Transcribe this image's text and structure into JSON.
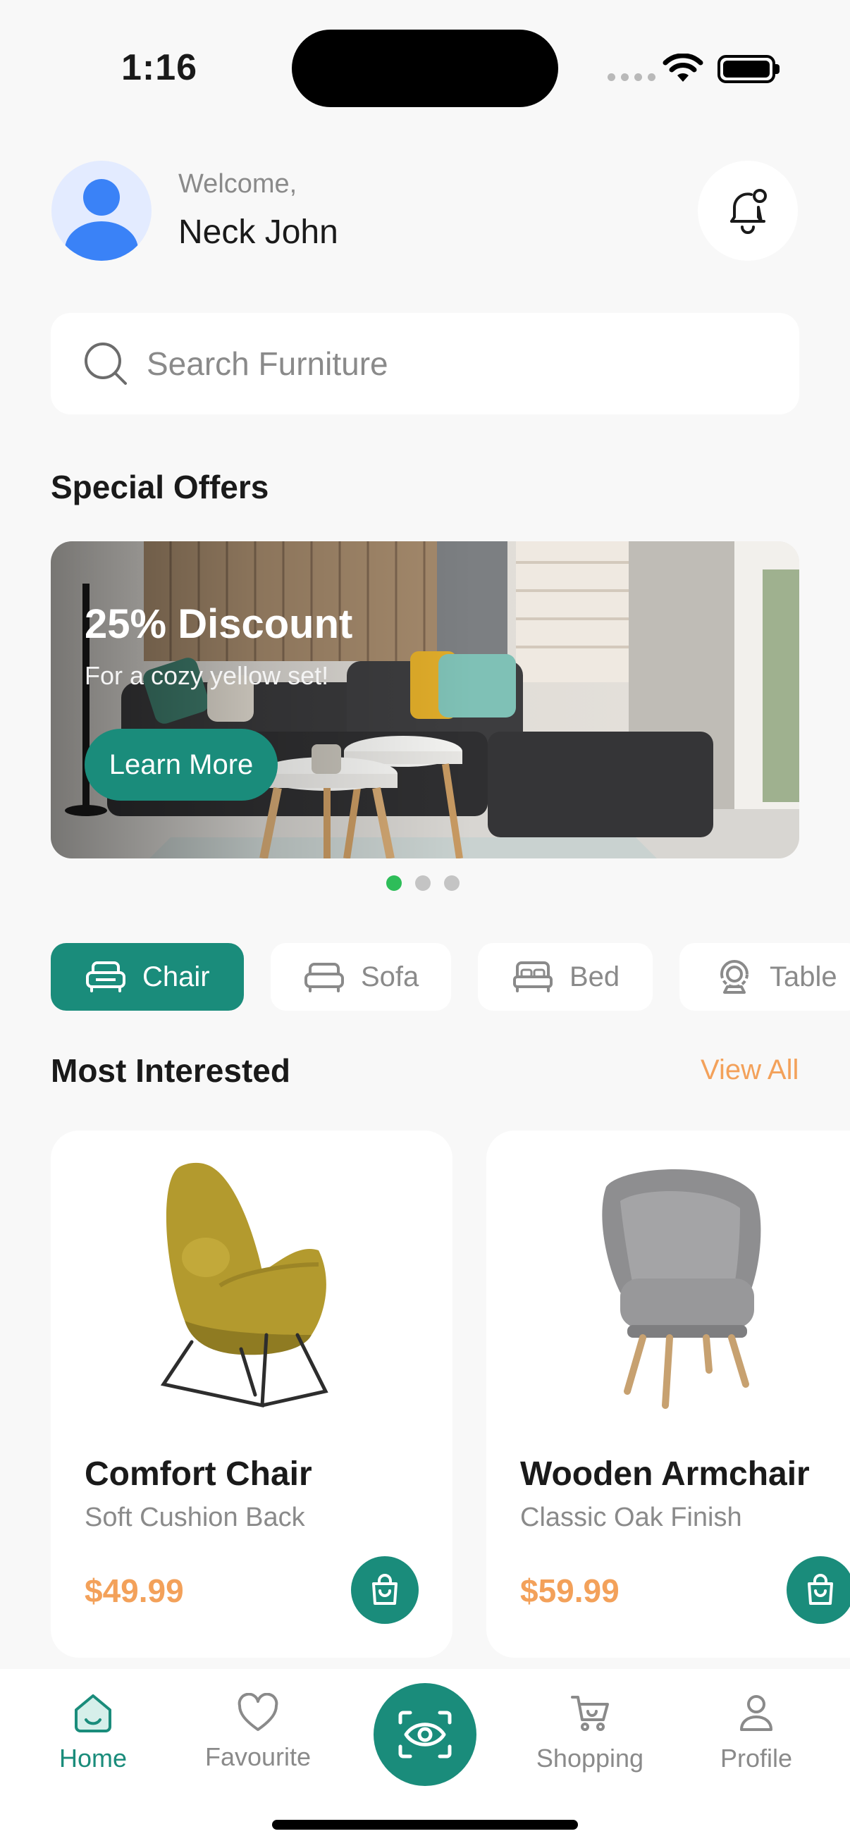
{
  "status": {
    "time": "1:16"
  },
  "header": {
    "welcome": "Welcome,",
    "username": "Neck John"
  },
  "search": {
    "placeholder": "Search Furniture"
  },
  "offers": {
    "title": "Special Offers",
    "banner_title": "25% Discount",
    "banner_subtitle": "For a cozy yellow set!",
    "cta": "Learn More",
    "page_count": 3,
    "active_page": 1
  },
  "categories": [
    {
      "label": "Chair",
      "icon": "armchair-icon",
      "active": true
    },
    {
      "label": "Sofa",
      "icon": "sofa-icon",
      "active": false
    },
    {
      "label": "Bed",
      "icon": "bed-icon",
      "active": false
    },
    {
      "label": "Table",
      "icon": "table-lamp-icon",
      "active": false
    }
  ],
  "most_interested": {
    "title": "Most Interested",
    "view_all": "View All",
    "products": [
      {
        "name": "Comfort Chair",
        "desc": "Soft Cushion Back",
        "price": "$49.99"
      },
      {
        "name": "Wooden Armchair",
        "desc": "Classic Oak Finish",
        "price": "$59.99"
      }
    ]
  },
  "nav": [
    {
      "label": "Home",
      "icon": "home-icon",
      "active": true
    },
    {
      "label": "Favourite",
      "icon": "heart-icon",
      "active": false
    },
    {
      "label": "",
      "icon": "scan-eye-icon",
      "active": false
    },
    {
      "label": "Shopping",
      "icon": "cart-icon",
      "active": false
    },
    {
      "label": "Profile",
      "icon": "user-icon",
      "active": false
    }
  ],
  "colors": {
    "accent": "#1a8c7b",
    "price": "#f3a15a",
    "dot_active": "#2ebd59",
    "background": "#f8f8f8"
  }
}
